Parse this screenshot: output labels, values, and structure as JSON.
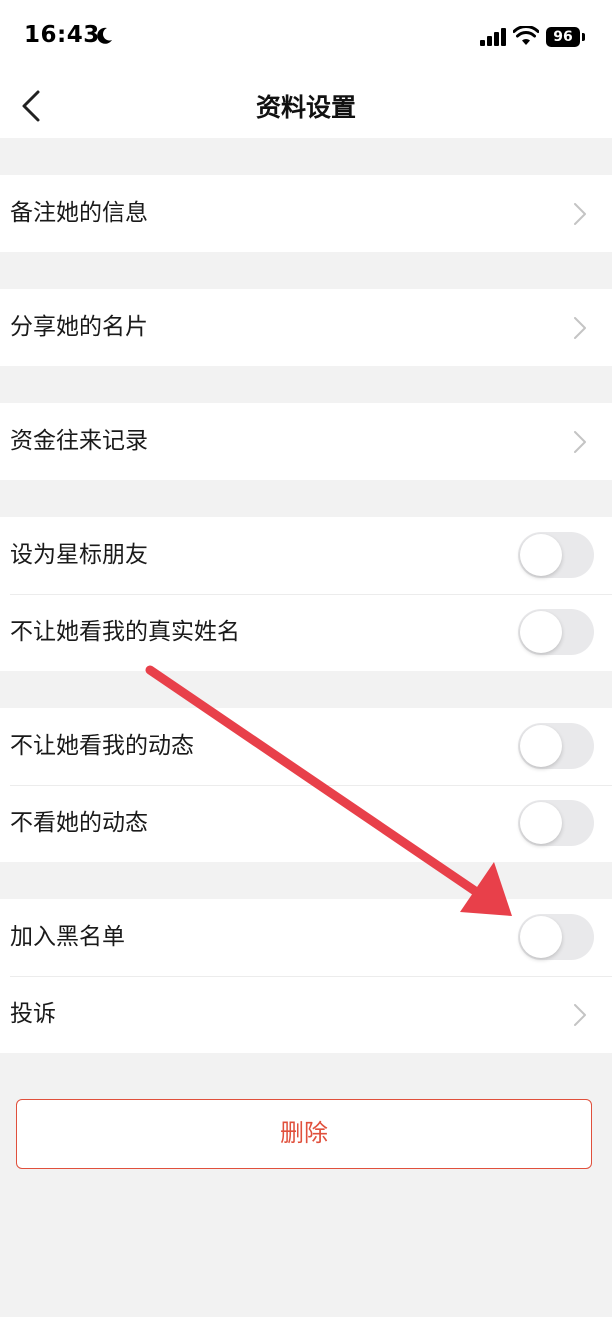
{
  "status_bar": {
    "time": "16:43",
    "battery": "96",
    "icons": [
      "moon-icon",
      "signal-icon",
      "wifi-icon",
      "battery-icon"
    ]
  },
  "navbar": {
    "title": "资料设置",
    "back_icon": "chevron-left-icon"
  },
  "sections": [
    [
      {
        "label": "备注她的信息",
        "control": "chevron"
      }
    ],
    [
      {
        "label": "分享她的名片",
        "control": "chevron"
      }
    ],
    [
      {
        "label": "资金往来记录",
        "control": "chevron"
      }
    ],
    [
      {
        "label": "设为星标朋友",
        "control": "toggle",
        "on": false
      },
      {
        "label": "不让她看我的真实姓名",
        "control": "toggle",
        "on": false
      }
    ],
    [
      {
        "label": "不让她看我的动态",
        "control": "toggle",
        "on": false
      },
      {
        "label": "不看她的动态",
        "control": "toggle",
        "on": false
      }
    ],
    [
      {
        "label": "加入黑名单",
        "control": "toggle",
        "on": false
      },
      {
        "label": "投诉",
        "control": "chevron"
      }
    ]
  ],
  "delete_button": {
    "label": "删除"
  },
  "colors": {
    "accent_red": "#e0503c",
    "annotation_arrow": "#e8404a",
    "background": "#f2f2f2",
    "toggle_off": "#e9e9eb"
  }
}
